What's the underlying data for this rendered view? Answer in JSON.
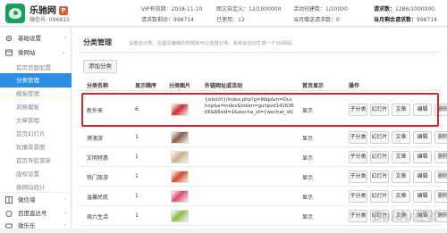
{
  "header": {
    "brand": "乐驰网",
    "badge": "P",
    "wechat_id": "微信号: 096815",
    "stats": [
      {
        "label": "VIP有效期：",
        "value": "2018-11-10"
      },
      {
        "label": "图文自定义：",
        "value": "12/1000000"
      },
      {
        "label": "活动创建数：",
        "value": "1/10000"
      },
      {
        "label": "请求数：",
        "value": "1286/1000000"
      },
      {
        "label": "请求数剩余：",
        "value": "998714"
      },
      {
        "label": "已使用：",
        "value": "12"
      },
      {
        "label": "当月赠送请求数：",
        "value": "0"
      },
      {
        "label": "当月剩余请求数：",
        "value": "998714"
      }
    ]
  },
  "sidebar": {
    "groups": [
      {
        "label": "基础设置",
        "icon": "gear-icon"
      },
      {
        "label": "微网站",
        "icon": "site-icon"
      },
      {
        "label": "微信墙",
        "icon": "wall-icon"
      },
      {
        "label": "百度直达号",
        "icon": "baidu-icon"
      },
      {
        "label": "微乐乐",
        "icon": "game-icon"
      }
    ],
    "sub_items": [
      "首页页面配置",
      "分类管理",
      "模板管理",
      "风格模板",
      "文章管理",
      "首页幻灯片",
      "轮播背景图",
      "首页导航菜单",
      "版权设置",
      "微网站统计"
    ],
    "active_sub": "分类管理"
  },
  "main": {
    "title": "分类管理",
    "description": "设置自分类，在图文编辑的时候就可以选择分类，系统会自动生成一个3G网站。",
    "add_button": "添加分类",
    "columns": [
      "分类名称",
      "显示顺序",
      "分类图片",
      "外链网址或活动",
      "首页显示",
      "操作"
    ],
    "rows": [
      {
        "name": "新外来",
        "order": "6",
        "link": "{siteUrl}/index.php?g=Wap&m=Dcshop&a=index&token=gunpvd14163606&66sid=1&wecha_id={wechat_id}",
        "home": "显示",
        "thumb_color": "#d22a2a"
      },
      {
        "name": "港澳游",
        "order": "1",
        "link": "",
        "home": "显示",
        "thumb_color": "#8a5a4a"
      },
      {
        "name": "文明特惠",
        "order": "1",
        "link": "",
        "home": "显示",
        "thumb_color": "#c8b08a"
      },
      {
        "name": "热门旅游",
        "order": "1",
        "link": "",
        "home": "显示",
        "thumb_color": "#d34a2a"
      },
      {
        "name": "温馨民航",
        "order": "1",
        "link": "",
        "home": "显示",
        "thumb_color": "#e04a6a"
      },
      {
        "name": "周六生活",
        "order": "1",
        "link": "",
        "home": "显示",
        "thumb_color": "#88c040"
      }
    ],
    "actions": [
      "子分类",
      "幻灯片",
      "文章",
      "编辑",
      "删除"
    ]
  },
  "watermark": "Baidu经验"
}
